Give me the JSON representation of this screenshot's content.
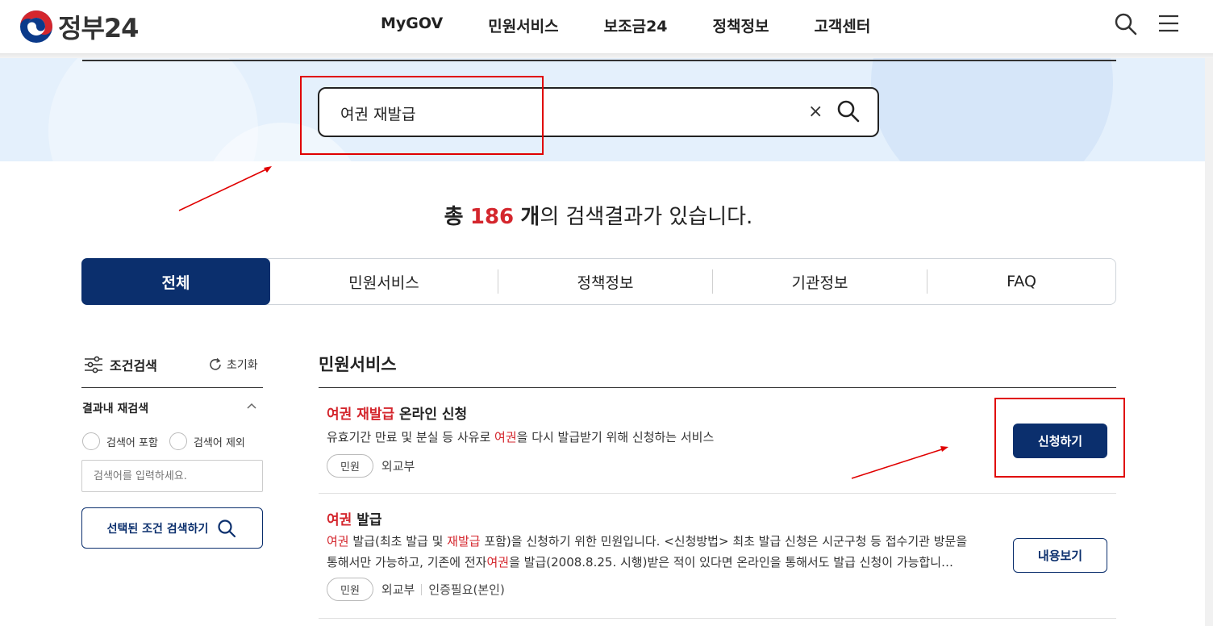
{
  "header": {
    "logo_text": "정부24",
    "nav": [
      "MyGOV",
      "민원서비스",
      "보조금24",
      "정책정보",
      "고객센터"
    ],
    "search_icon": "search-icon",
    "menu_icon": "hamburger-menu-icon"
  },
  "search": {
    "value": "여권 재발급",
    "clear_label": "×"
  },
  "result_count": {
    "prefix": "총",
    "count": "186",
    "unit": "개",
    "suffix": "의 검색결과가 있습니다."
  },
  "tabs": [
    "전체",
    "민원서비스",
    "정책정보",
    "기관정보",
    "FAQ"
  ],
  "sidebar": {
    "title": "조건검색",
    "reset_label": "초기화",
    "section_label": "결과내 재검색",
    "include_label": "검색어 포함",
    "exclude_label": "검색어 제외",
    "input_placeholder": "검색어를 입력하세요.",
    "search_button": "선택된 조건 검색하기"
  },
  "main": {
    "section_title": "민원서비스",
    "results": [
      {
        "title_highlight": "여권 재발급",
        "title_rest": " 온라인 신청",
        "desc_1": "유효기간 만료 및 분실 등 사유로 ",
        "desc_hl": "여권",
        "desc_2": "을 다시 발급받기 위해 신청하는 서비스",
        "badge": "민원",
        "org": "외교부",
        "button": "신청하기"
      },
      {
        "title_highlight": "여권",
        "title_rest": " 발급",
        "desc_hl1": "여권",
        "desc_a": " 발급(최초 발급 및 ",
        "desc_hl2": "재발급",
        "desc_b": " 포함)을 신청하기 위한 민원입니다. <신청방법> 최초 발급 신청은 시군구청 등 접수기관 방문을",
        "desc_c": "통해서만 가능하고, 기존에 전자",
        "desc_hl3": "여권",
        "desc_d": "을 발급(2008.8.25. 시행)받은 적이 있다면 온라인을 통해서도 발급 신청이 가능합니…",
        "badge": "민원",
        "org": "외교부",
        "auth": "인증필요(본인)",
        "button": "내용보기"
      }
    ]
  },
  "colors": {
    "primary": "#0b2f6d",
    "highlight": "#d4262d",
    "band": "#e4f0fc",
    "annotation": "#e00000"
  }
}
